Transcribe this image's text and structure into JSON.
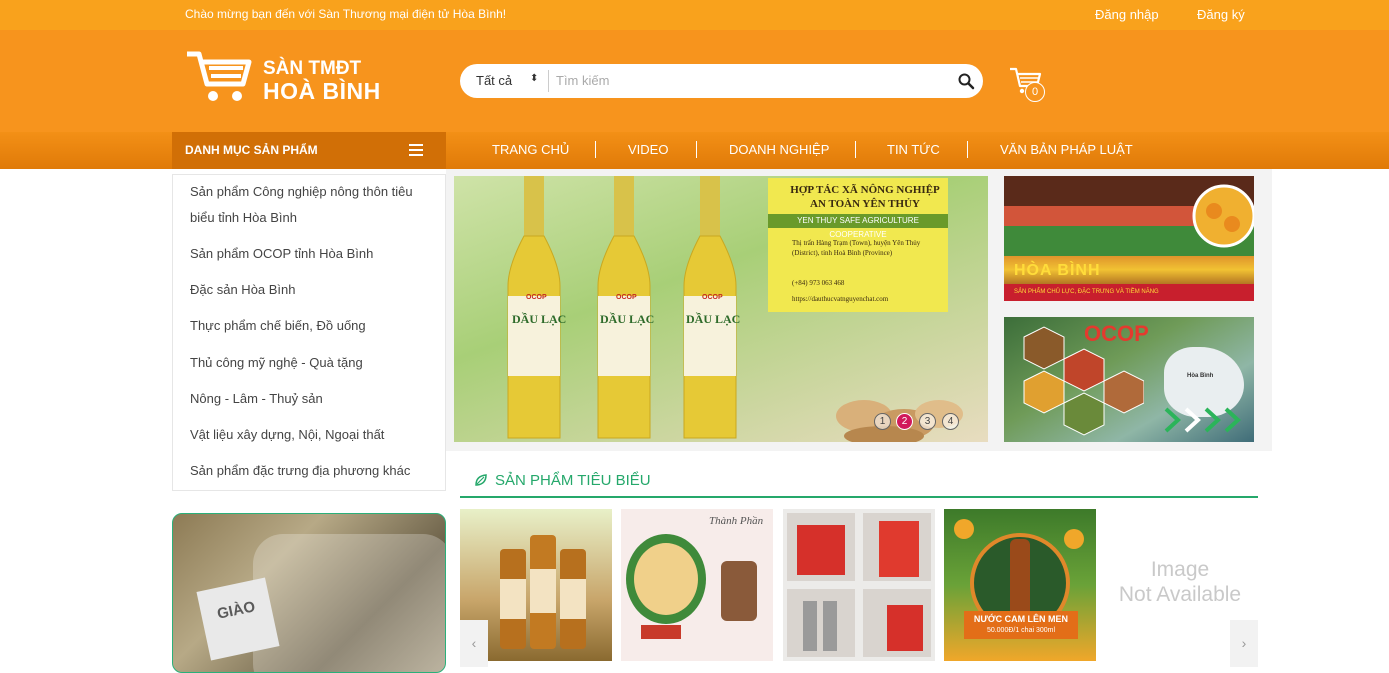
{
  "topbar": {
    "welcome": "Chào mừng bạn đến với Sàn Thương mại điện tử Hòa Bình!",
    "login": "Đăng nhập",
    "register": "Đăng ký"
  },
  "logo": {
    "line1": "SÀN TMĐT",
    "line2": "HOÀ BÌNH"
  },
  "search": {
    "category": "Tất cả",
    "placeholder": "Tìm kiếm"
  },
  "cart": {
    "count": "0"
  },
  "nav": {
    "category_button": "DANH MỤC SẢN PHẨM",
    "items": [
      "TRANG CHỦ",
      "VIDEO",
      "DOANH NGHIỆP",
      "TIN TỨC",
      "VĂN BẢN PHÁP LUẬT"
    ]
  },
  "categories": [
    "Sản phẩm Công nghiệp nông thôn tiêu biểu tỉnh Hòa Bình",
    "Sản phẩm OCOP tỉnh Hòa Bình",
    "Đặc sản Hòa Bình",
    "Thực phẩm chế biến, Đồ uống",
    "Thủ công mỹ nghệ - Quà tặng",
    "Nông - Lâm - Thuỷ sản",
    "Vật liệu xây dựng, Nội, Ngoại thất",
    "Sản phẩm đặc trưng địa phương khác"
  ],
  "banner": {
    "bottle_label": "DẦU LẠC",
    "ocop_label": "OCOP",
    "coop_line1": "HỢP TÁC XÃ NÔNG NGHIỆP",
    "coop_line2": "AN TOÀN YÊN THỦY",
    "coop_english": "YEN THUY SAFE AGRICULTURE COOPERATIVE",
    "coop_address": "Thị trấn Hàng Trạm (Town), huyện Yên Thủy (District), tỉnh Hoà Bình (Province)",
    "coop_phone": "(+84) 973 063 468",
    "coop_web": "https://dauthucvatnguyenchat.com",
    "dots": [
      "1",
      "2",
      "3",
      "4"
    ],
    "active_dot": 2
  },
  "side_banners": {
    "hoa_binh": "HÒA BÌNH",
    "hoa_binh_strip": "SẢN PHẨM CHỦ LỰC, ĐẶC TRƯNG VÀ TIỀM NĂNG",
    "ocop": "OCOP",
    "map_label": "Hòa Bình"
  },
  "featured": {
    "title": "SẢN PHẨM TIÊU BIỂU",
    "p2_title": "Thành Phần",
    "p4_caption_line1": "NƯỚC CAM LÊN MEN",
    "p4_caption_line2": "50.000Đ/1 chai 300ml",
    "p5_placeholder_line1": "Image",
    "p5_placeholder_line2": "Not Available"
  },
  "promo": {
    "tag": "GIÀO"
  },
  "colors": {
    "topbar": "#f9a21c",
    "header": "#f7941d",
    "nav_dark": "#d16f06",
    "accent_green": "#25a86b",
    "dot_active": "#d1195b"
  }
}
